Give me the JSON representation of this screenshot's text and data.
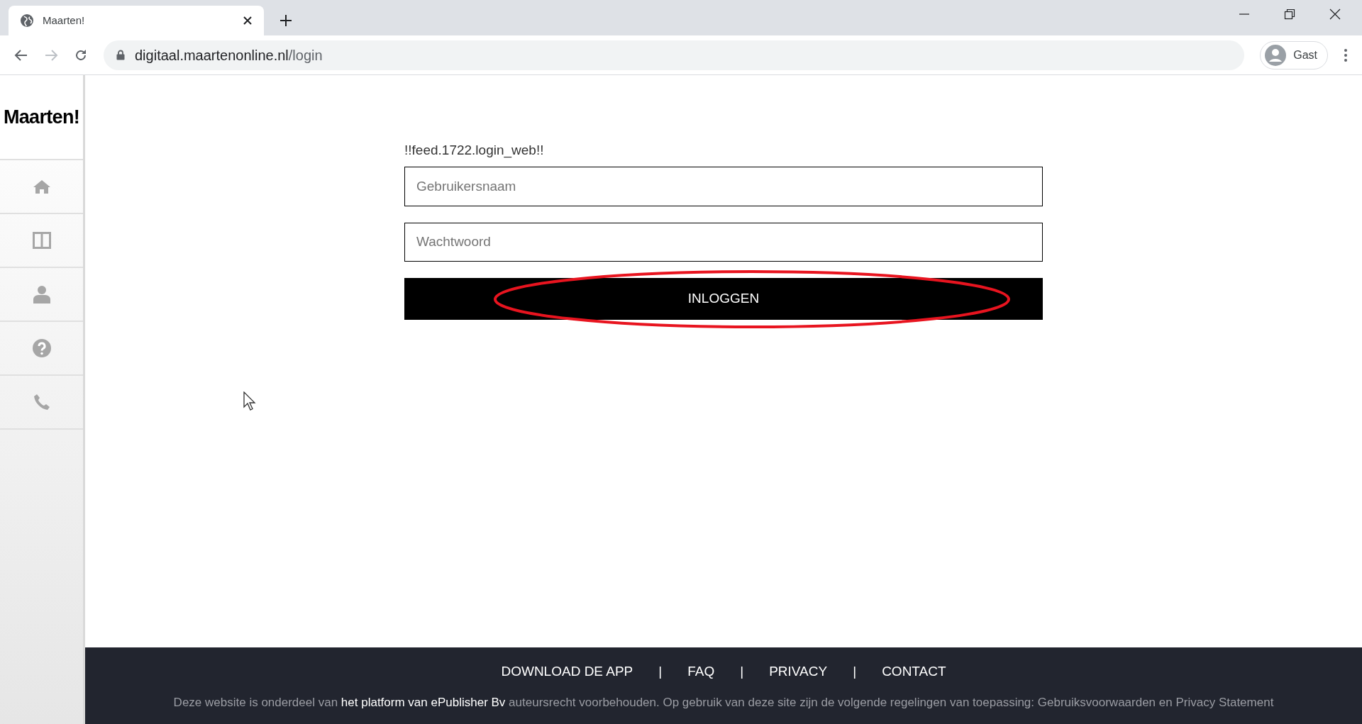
{
  "browser": {
    "tab_title": "Maarten!",
    "url_host": "digitaal.maartenonline.nl",
    "url_path": "/login",
    "profile": "Gast"
  },
  "sidebar": {
    "logo": "Maarten!"
  },
  "login": {
    "heading": "!!feed.1722.login_web!!",
    "username": {
      "placeholder": "Gebruikersnaam"
    },
    "password": {
      "placeholder": "Wachtwoord"
    },
    "button": "INLOGGEN"
  },
  "footer": {
    "links": [
      {
        "label": "DOWNLOAD DE APP"
      },
      {
        "label": "FAQ"
      },
      {
        "label": "PRIVACY"
      },
      {
        "label": "CONTACT"
      }
    ],
    "separator": "|",
    "notice_before": "Deze website is onderdeel van",
    "notice_link": "het platform van ePublisher Bv",
    "notice_after": "auteursrecht voorbehouden. Op gebruik van deze site zijn de volgende regelingen van toepassing: Gebruiksvoorwaarden en Privacy Statement"
  }
}
